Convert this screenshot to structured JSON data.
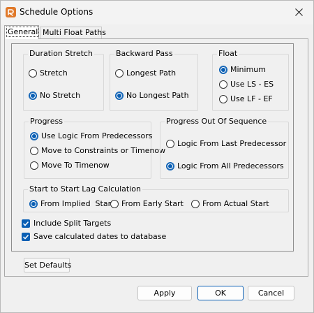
{
  "window": {
    "title": "Schedule Options",
    "close_glyph": "✕"
  },
  "tabs": [
    {
      "label": "General",
      "selected": true
    },
    {
      "label": "Multi Float Paths",
      "selected": false
    }
  ],
  "groups": {
    "duration_stretch": {
      "title": "Duration Stretch",
      "options": [
        {
          "label": "Stretch",
          "checked": false
        },
        {
          "label": "No Stretch",
          "checked": true
        }
      ]
    },
    "backward_pass": {
      "title": "Backward Pass",
      "options": [
        {
          "label": "Longest Path",
          "checked": false
        },
        {
          "label": "No Longest Path",
          "checked": true
        }
      ]
    },
    "float": {
      "title": "Float",
      "options": [
        {
          "label": "Minimum",
          "checked": true
        },
        {
          "label": "Use LS - ES",
          "checked": false
        },
        {
          "label": "Use LF - EF",
          "checked": false
        }
      ]
    },
    "progress": {
      "title": "Progress",
      "options": [
        {
          "label": "Use Logic From Predecessors",
          "checked": true
        },
        {
          "label": "Move to Constraints or Timenow",
          "checked": false
        },
        {
          "label": "Move To Timenow",
          "checked": false
        }
      ]
    },
    "progress_out_of_sequence": {
      "title": "Progress Out Of Sequence",
      "options": [
        {
          "label": "Logic From Last Predecessor",
          "checked": false
        },
        {
          "label": "Logic From All Predecessors",
          "checked": true
        }
      ]
    },
    "start_to_start": {
      "title": "Start to Start Lag Calculation",
      "options": [
        {
          "label": "From Implied  Start",
          "checked": true
        },
        {
          "label": "From Early Start",
          "checked": false
        },
        {
          "label": "From Actual Start",
          "checked": false
        }
      ]
    }
  },
  "checkboxes": [
    {
      "label": "Include Split Targets",
      "checked": true
    },
    {
      "label": "Save calculated dates to database",
      "checked": true
    }
  ],
  "buttons": {
    "set_defaults": "Set Defaults",
    "apply": "Apply",
    "ok": "OK",
    "cancel": "Cancel"
  },
  "colors": {
    "accent": "#0a5fb4",
    "app_icon": "#e0792a"
  },
  "icons": {
    "app": "app-logo-icon",
    "close": "close-icon",
    "check": "checkmark-icon"
  }
}
